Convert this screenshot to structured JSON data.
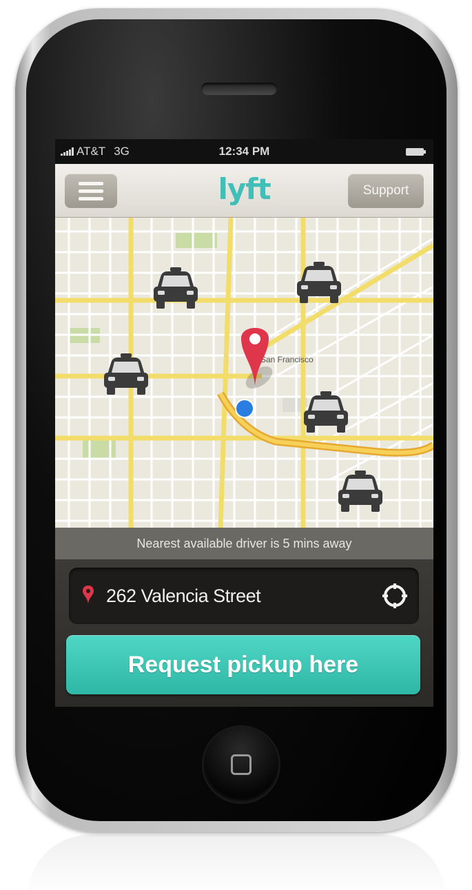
{
  "status_bar": {
    "carrier": "AT&T",
    "network": "3G",
    "time": "12:34 PM"
  },
  "nav": {
    "logo_text": "lyft",
    "support_label": "Support",
    "brand_color": "#3fbfb7"
  },
  "map": {
    "pickup_pin_color": "#e0364b",
    "current_location_color": "#2a7de1",
    "label": "San Francisco"
  },
  "eta_message": "Nearest available driver is 5 mins away",
  "pickup": {
    "address": "262 Valencia Street"
  },
  "request_button": {
    "label": "Request pickup here",
    "color": "#3cc6b5"
  },
  "icons": {
    "menu": "hamburger-icon",
    "car": "car-icon",
    "pin": "location-pin-icon",
    "locate": "crosshair-icon",
    "home": "home-button"
  }
}
